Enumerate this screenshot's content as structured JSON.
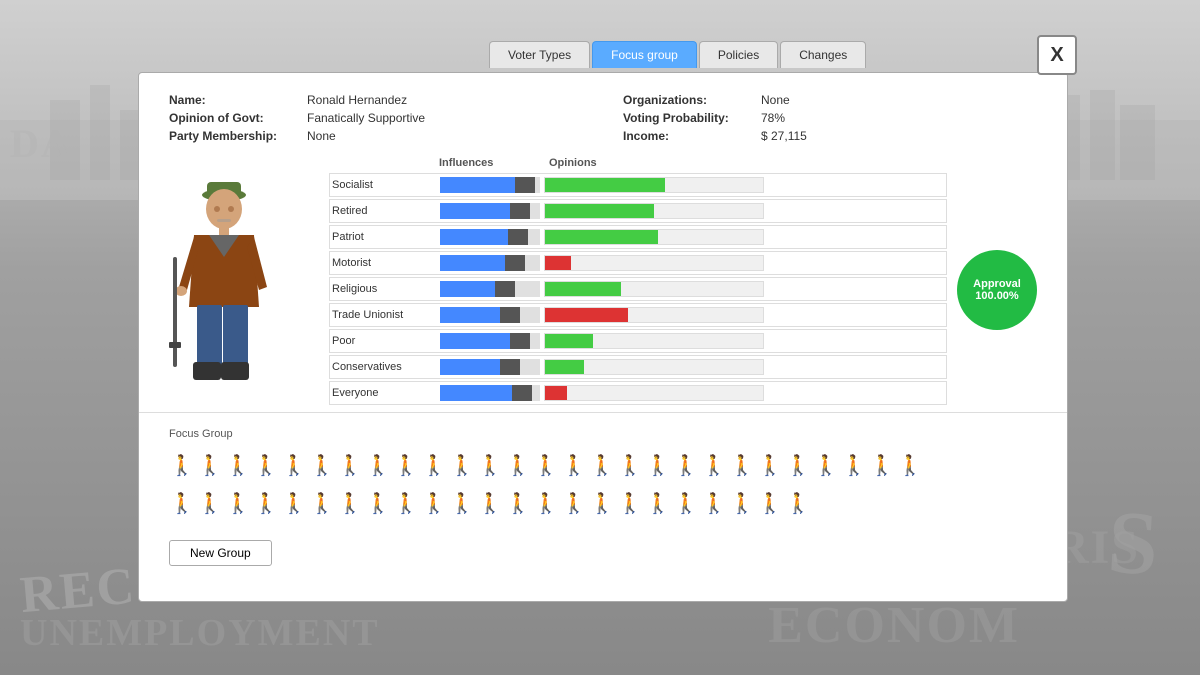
{
  "background": {
    "newspaper_texts": [
      "DA",
      "RECORD",
      "UNEMPLOYMENT",
      "S",
      "N CRIS",
      "ECONOM"
    ]
  },
  "tabs": [
    {
      "id": "voter-types",
      "label": "Voter Types",
      "active": false
    },
    {
      "id": "focus-group",
      "label": "Focus group",
      "active": true
    },
    {
      "id": "policies",
      "label": "Policies",
      "active": false
    },
    {
      "id": "changes",
      "label": "Changes",
      "active": false
    }
  ],
  "close_label": "X",
  "person": {
    "name_label": "Name:",
    "name_value": "Ronald Hernandez",
    "opinion_label": "Opinion of Govt:",
    "opinion_value": "Fanatically Supportive",
    "party_label": "Party Membership:",
    "party_value": "None",
    "org_label": "Organizations:",
    "org_value": "None",
    "voting_label": "Voting Probability:",
    "voting_value": "78%",
    "income_label": "Income:",
    "income_value": "$ 27,115"
  },
  "table": {
    "col_influences": "Influences",
    "col_opinions": "Opinions",
    "rows": [
      {
        "label": "Socialist",
        "influence_blue": 75,
        "influence_dark": 20,
        "opinion_type": "green",
        "opinion_pct": 55
      },
      {
        "label": "Retired",
        "influence_blue": 70,
        "influence_dark": 20,
        "opinion_type": "green",
        "opinion_pct": 50
      },
      {
        "label": "Patriot",
        "influence_blue": 68,
        "influence_dark": 20,
        "opinion_type": "green",
        "opinion_pct": 52
      },
      {
        "label": "Motorist",
        "influence_blue": 65,
        "influence_dark": 20,
        "opinion_type": "red",
        "opinion_pct": 12
      },
      {
        "label": "Religious",
        "influence_blue": 55,
        "influence_dark": 20,
        "opinion_type": "green",
        "opinion_pct": 35
      },
      {
        "label": "Trade Unionist",
        "influence_blue": 60,
        "influence_dark": 20,
        "opinion_type": "red",
        "opinion_pct": 38
      },
      {
        "label": "Poor",
        "influence_blue": 70,
        "influence_dark": 20,
        "opinion_type": "green",
        "opinion_pct": 22
      },
      {
        "label": "Conservatives",
        "influence_blue": 60,
        "influence_dark": 20,
        "opinion_type": "green",
        "opinion_pct": 18
      },
      {
        "label": "Everyone",
        "influence_blue": 72,
        "influence_dark": 20,
        "opinion_type": "red",
        "opinion_pct": 10
      }
    ]
  },
  "approval": {
    "label": "Approval",
    "value": "100.00%",
    "color": "#22bb44"
  },
  "focus_group": {
    "label": "Focus Group",
    "new_group_label": "New Group",
    "count": 50,
    "dark_index": 18
  }
}
